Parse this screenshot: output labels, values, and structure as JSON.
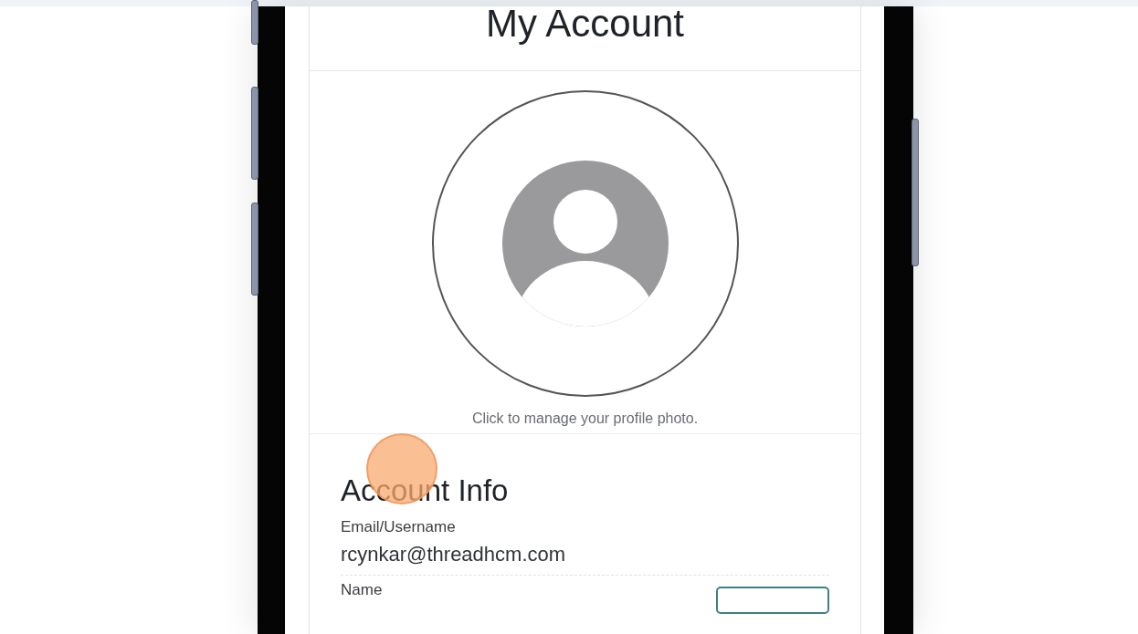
{
  "page": {
    "title": "My Account"
  },
  "profile": {
    "caption": "Click to manage your profile photo."
  },
  "account_info": {
    "heading": "Account Info",
    "fields": [
      {
        "kind": "value",
        "label": "Email/Username",
        "value": "rcynkar@threadhcm.com"
      },
      {
        "kind": "button",
        "label": "Name"
      }
    ]
  }
}
